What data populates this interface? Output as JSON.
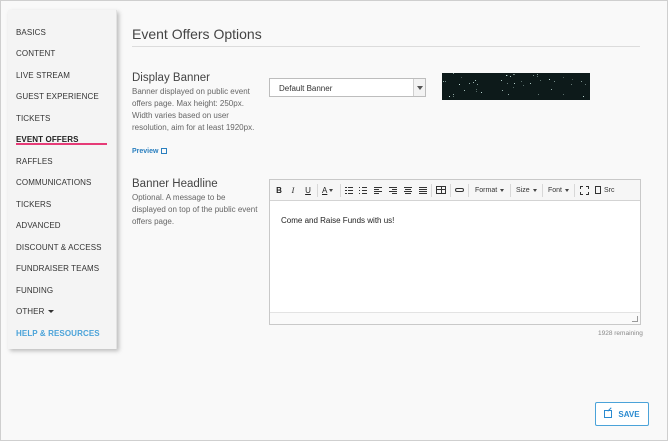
{
  "sidebar": {
    "items": [
      {
        "label": "BASICS"
      },
      {
        "label": "CONTENT"
      },
      {
        "label": "LIVE STREAM"
      },
      {
        "label": "GUEST EXPERIENCE"
      },
      {
        "label": "TICKETS"
      },
      {
        "label": "EVENT OFFERS"
      },
      {
        "label": "RAFFLES"
      },
      {
        "label": "COMMUNICATIONS"
      },
      {
        "label": "TICKERS"
      },
      {
        "label": "ADVANCED"
      },
      {
        "label": "DISCOUNT & ACCESS"
      },
      {
        "label": "FUNDRAISER TEAMS"
      },
      {
        "label": "FUNDING"
      },
      {
        "label": "OTHER"
      },
      {
        "label": "HELP & RESOURCES"
      }
    ],
    "active": "EVENT OFFERS",
    "accent_color": "#e63b77",
    "help_color": "#4ba3d9"
  },
  "page": {
    "title": "Event Offers Options"
  },
  "display_banner": {
    "title": "Display Banner",
    "description": "Banner displayed on public event offers page. Max height: 250px. Width varies based on user resolution, aim for at least 1920px.",
    "preview_label": "Preview",
    "select_value": "Default Banner"
  },
  "banner_headline": {
    "title": "Banner Headline",
    "description": "Optional. A message to be displayed on top of the public event offers page.",
    "content": "Come and Raise Funds with us!",
    "remaining": "1928 remaining",
    "toolbar": {
      "bold": "B",
      "italic": "I",
      "underline": "U",
      "text_color": "A",
      "format": "Format",
      "size": "Size",
      "font": "Font",
      "source": "Src"
    }
  },
  "actions": {
    "save_label": "SAVE"
  }
}
